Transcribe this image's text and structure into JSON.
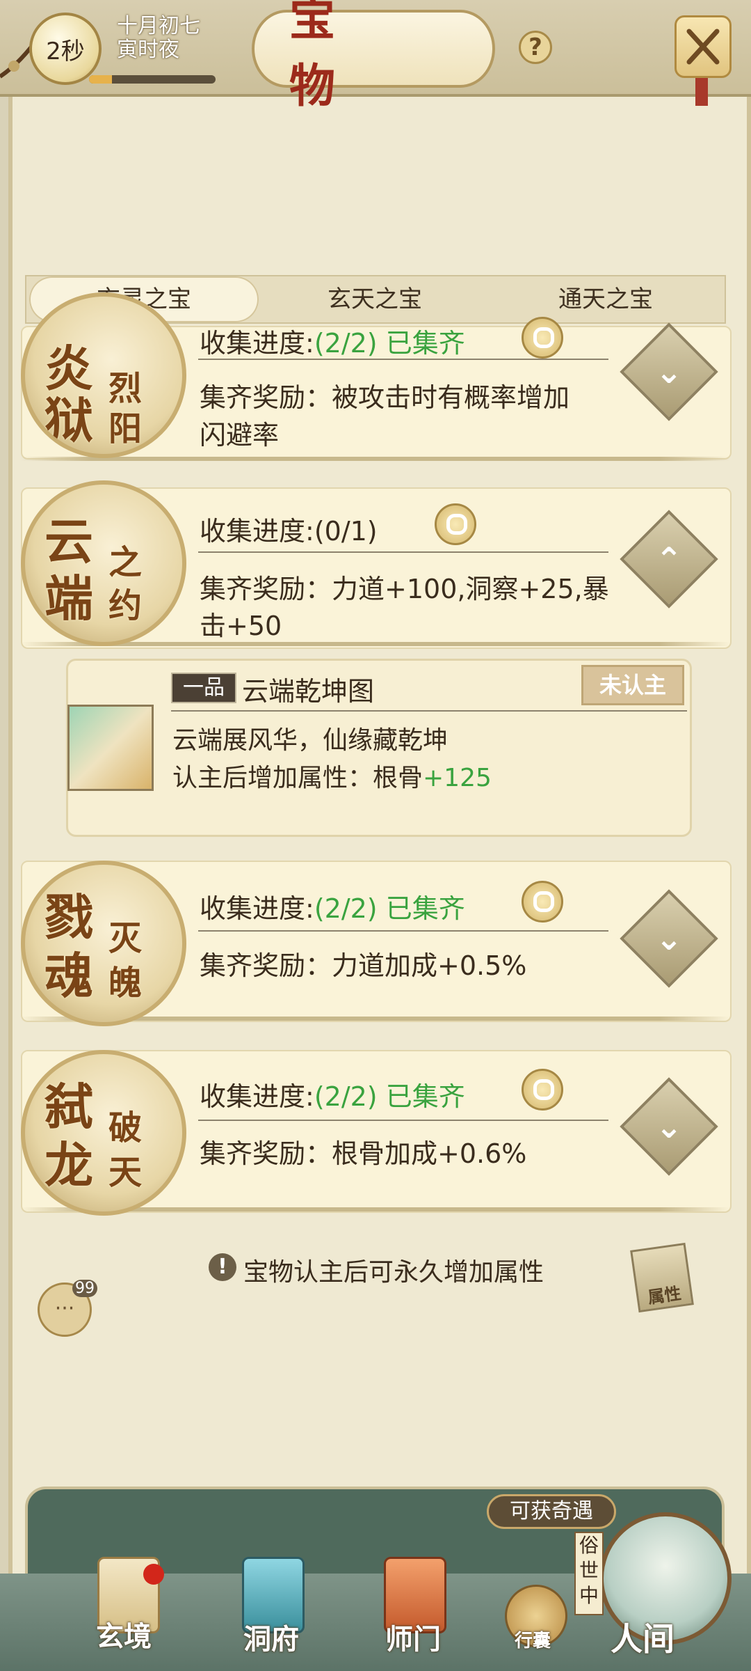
{
  "header": {
    "timer": "2秒",
    "date_line1": "十月初七",
    "date_line2": "寅时夜",
    "title": "宝 物",
    "help": "?"
  },
  "tabs": [
    {
      "label": "玄灵之宝",
      "active": true
    },
    {
      "label": "玄天之宝",
      "active": false
    },
    {
      "label": "通天之宝",
      "active": false
    }
  ],
  "sets": [
    {
      "emblem_big": [
        "炎",
        "狱"
      ],
      "emblem_small": [
        "烈",
        "阳"
      ],
      "progress_label": "收集进度:",
      "progress_value": "(2/2)",
      "status": "已集齐",
      "reward_label": "集齐奖励：",
      "reward_text_1": "被攻击时有概率增加",
      "reward_text_2": "闪避率",
      "arrow": "down"
    },
    {
      "emblem_big": [
        "云",
        "端"
      ],
      "emblem_small": [
        "之",
        "约"
      ],
      "progress_label": "收集进度:",
      "progress_value": "(0/1)",
      "status": "",
      "reward_label": "集齐奖励：",
      "reward_text_1": "力道+100,洞察+25,暴",
      "reward_text_2": "击+50",
      "arrow": "up"
    },
    {
      "emblem_big": [
        "戮",
        "魂"
      ],
      "emblem_small": [
        "灭",
        "魄"
      ],
      "progress_label": "收集进度:",
      "progress_value": "(2/2)",
      "status": "已集齐",
      "reward_label": "集齐奖励：",
      "reward_text_1": "力道加成+0.5%",
      "arrow": "down"
    },
    {
      "emblem_big": [
        "弑",
        "龙"
      ],
      "emblem_small": [
        "破",
        "天"
      ],
      "progress_label": "收集进度:",
      "progress_value": "(2/2)",
      "status": "已集齐",
      "reward_label": "集齐奖励：",
      "reward_text_1": "根骨加成+0.6%",
      "arrow": "down"
    }
  ],
  "item": {
    "grade": "一品",
    "name": "云端乾坤图",
    "status": "未认主",
    "desc": "云端展风华，仙缘藏乾坤",
    "attr_label": "认主后增加属性：根骨",
    "attr_value": "+125"
  },
  "notice": "宝物认主后可永久增加属性",
  "chat_badge": "99",
  "attr_button": "属性",
  "nav": {
    "adventure_tag": "可获奇遇",
    "vertical_status": "俗世中",
    "items": [
      {
        "label": "玄境"
      },
      {
        "label": "洞府"
      },
      {
        "label": "师门"
      },
      {
        "label": "行囊"
      },
      {
        "label": "人间"
      }
    ]
  },
  "colors": {
    "accent_green": "#3aa33f",
    "title_red": "#9c2a1b",
    "panel_bg": "#faf3d8"
  }
}
